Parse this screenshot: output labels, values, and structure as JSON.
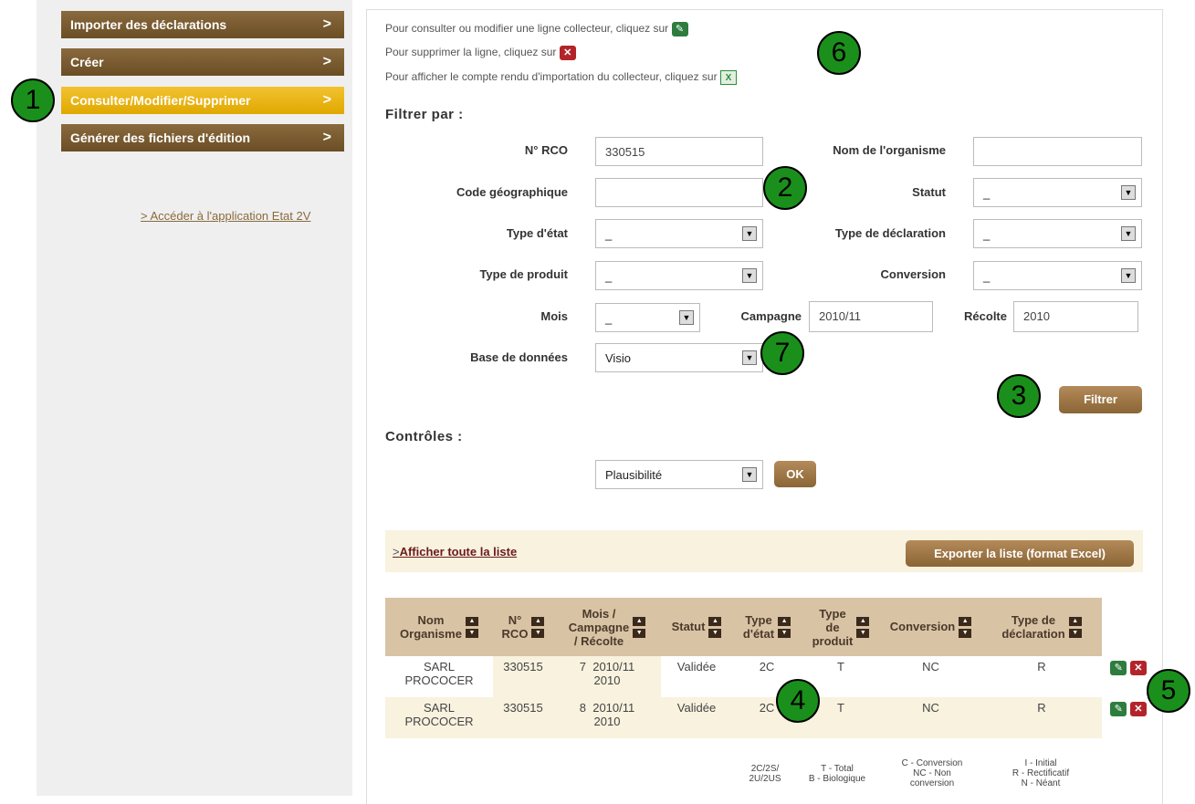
{
  "sidebar": {
    "menu": [
      {
        "label": "Importer des déclarations"
      },
      {
        "label": "Créer"
      },
      {
        "label": "Consulter/Modifier/Supprimer"
      },
      {
        "label": "Générer des fichiers d'édition"
      }
    ],
    "chevron": ">",
    "link": "> Accéder à l'application Etat 2V"
  },
  "info": {
    "line1": "Pour consulter ou modifier une ligne collecteur, cliquez sur",
    "line2": "Pour supprimer la ligne, cliquez sur",
    "line3": "Pour afficher le compte rendu d'importation du collecteur, cliquez sur"
  },
  "filter": {
    "title": "Filtrer par :",
    "rco_label": "N° RCO",
    "rco_value": "330515",
    "org_label": "Nom de l'organisme",
    "org_value": "",
    "geo_label": "Code géographique",
    "geo_value": "",
    "statut_label": "Statut",
    "statut_value": "_",
    "type_etat_label": "Type d'état",
    "type_etat_value": "_",
    "type_decl_label": "Type de déclaration",
    "type_decl_value": "_",
    "type_prod_label": "Type de produit",
    "type_prod_value": "_",
    "conversion_label": "Conversion",
    "conversion_value": "_",
    "mois_label": "Mois",
    "mois_value": "_",
    "campagne_label": "Campagne",
    "campagne_value": "2010/11",
    "recolte_label": "Récolte",
    "recolte_value": "2010",
    "base_label": "Base de données",
    "base_value": "Visio",
    "button": "Filtrer"
  },
  "controles": {
    "title": "Contrôles :",
    "value": "Plausibilité",
    "button": "OK"
  },
  "list": {
    "show_all": "Afficher toute la liste",
    "show_all_prefix": ">",
    "export": "Exporter la liste (format Excel)"
  },
  "table": {
    "headers": {
      "nom": [
        "Nom",
        "Organisme"
      ],
      "rco": [
        "N°",
        "RCO"
      ],
      "mois": [
        "Mois /",
        "Campagne",
        "/ Récolte"
      ],
      "statut": "Statut",
      "type_etat": [
        "Type",
        "d'état"
      ],
      "type_prod": [
        "Type",
        "de",
        "produit"
      ],
      "conversion": "Conversion",
      "type_decl": [
        "Type de",
        "déclaration"
      ]
    },
    "rows": [
      {
        "nom1": "SARL",
        "nom2": "PROCOCER",
        "rco": "330515",
        "mois": "7",
        "campagne": "2010/11",
        "recolte": "2010",
        "statut": "Validée",
        "type_etat": "2C",
        "type_prod": "T",
        "conversion": "NC",
        "type_decl": "R"
      },
      {
        "nom1": "SARL",
        "nom2": "PROCOCER",
        "rco": "330515",
        "mois": "8",
        "campagne": "2010/11",
        "recolte": "2010",
        "statut": "Validée",
        "type_etat": "2C",
        "type_prod": "T",
        "conversion": "NC",
        "type_decl": "R"
      }
    ],
    "legend": {
      "etat": [
        "2C/2S/",
        "2U/2US"
      ],
      "prod": [
        "T - Total",
        "B - Biologique"
      ],
      "conv": [
        "C - Conversion",
        "NC - Non",
        "conversion"
      ],
      "decl": [
        "I - Initial",
        "R - Rectificatif",
        "N - Néant"
      ]
    }
  },
  "callouts": [
    "1",
    "2",
    "3",
    "4",
    "5",
    "6",
    "7"
  ],
  "icons": {
    "edit": "pencil-icon",
    "delete": "x-icon",
    "excel": "excel-icon",
    "arrow_up": "▲",
    "arrow_down": "▼",
    "select_arrow": "▼"
  },
  "colors": {
    "menu": "#7a5a30",
    "active": "#e8b61a",
    "callout": "#1b8f1b",
    "header": "#d9c3a5"
  }
}
